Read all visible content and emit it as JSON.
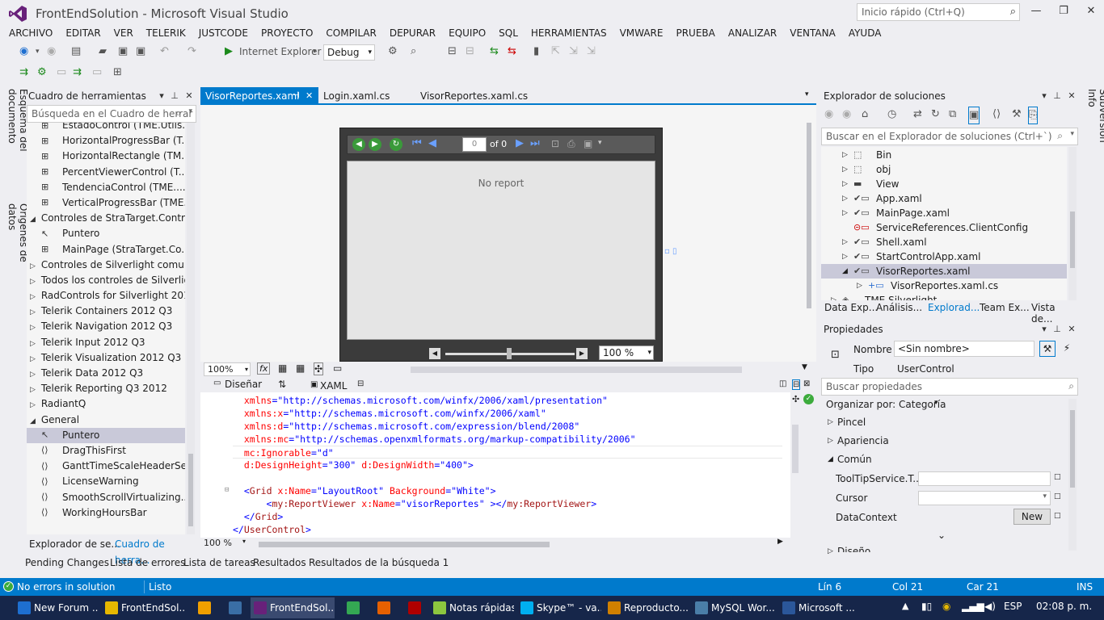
{
  "title": {
    "app": "FrontEndSolution - Microsoft Visual Studio",
    "quick_launch": "Inicio rápido (Ctrl+Q)"
  },
  "menu": [
    "ARCHIVO",
    "EDITAR",
    "VER",
    "TELERIK",
    "JUSTCODE",
    "PROYECTO",
    "COMPILAR",
    "DEPURAR",
    "EQUIPO",
    "SQL",
    "HERRAMIENTAS",
    "VMWARE",
    "PRUEBA",
    "ANALIZAR",
    "VENTANA",
    "AYUDA"
  ],
  "toolbar": {
    "run_target": "Internet Explorer",
    "config": "Debug"
  },
  "left_vtabs": [
    "Esquema del documento",
    "Orígenes de datos"
  ],
  "right_vtab": "Subversion Info",
  "toolbox": {
    "title": "Cuadro de herramientas",
    "search_placeholder": "Búsqueda en el Cuadro de herrar",
    "items": [
      {
        "type": "item",
        "label": "EstadoControl (TME.Utils..."
      },
      {
        "type": "item",
        "label": "HorizontalProgressBar (T..."
      },
      {
        "type": "item",
        "label": "HorizontalRectangle (TM..."
      },
      {
        "type": "item",
        "label": "PercentViewerControl (T..."
      },
      {
        "type": "item",
        "label": "TendenciaControl (TME...."
      },
      {
        "type": "item",
        "label": "VerticalProgressBar (TME..."
      },
      {
        "type": "group-open",
        "label": "Controles de StraTarget.Contro..."
      },
      {
        "type": "pointer",
        "label": "Puntero"
      },
      {
        "type": "item",
        "label": "MainPage (StraTarget.Co..."
      },
      {
        "type": "group",
        "label": "Controles de Silverlight comunes"
      },
      {
        "type": "group",
        "label": "Todos los controles de Silverlight"
      },
      {
        "type": "group",
        "label": "RadControls for Silverlight 2012..."
      },
      {
        "type": "group",
        "label": "Telerik Containers 2012 Q3"
      },
      {
        "type": "group",
        "label": "Telerik Navigation 2012 Q3"
      },
      {
        "type": "group",
        "label": "Telerik Input 2012 Q3"
      },
      {
        "type": "group",
        "label": "Telerik Visualization 2012 Q3"
      },
      {
        "type": "group",
        "label": "Telerik Data 2012 Q3"
      },
      {
        "type": "group",
        "label": "Telerik Reporting Q3 2012"
      },
      {
        "type": "group",
        "label": "RadiantQ"
      },
      {
        "type": "group-open",
        "label": "General"
      },
      {
        "type": "pointer-sel",
        "label": "Puntero"
      },
      {
        "type": "code",
        "label": "DragThisFirst"
      },
      {
        "type": "code",
        "label": "GanttTimeScaleHeaderSe..."
      },
      {
        "type": "code",
        "label": "LicenseWarning"
      },
      {
        "type": "code",
        "label": "SmoothScrollVirtualizing..."
      },
      {
        "type": "code",
        "label": "WorkingHoursBar"
      }
    ],
    "bottom_tabs": [
      "Explorador de se...",
      "Cuadro de herra..."
    ]
  },
  "doc_tabs": [
    {
      "label": "VisorReportes.xaml",
      "active": true
    },
    {
      "label": "Login.xaml.cs",
      "active": false
    },
    {
      "label": "VisorReportes.xaml.cs",
      "active": false
    }
  ],
  "report_viewer": {
    "page": "0",
    "of": "of 0",
    "no_report": "No report",
    "zoom": "100 %"
  },
  "designer": {
    "zoom": "100%",
    "fx": "fx",
    "tab_design": "Diseñar",
    "tab_xaml": "XAML"
  },
  "code": [
    {
      "indent": "  ",
      "parts": [
        [
          "attr",
          "xmlns"
        ],
        [
          "punct",
          "="
        ],
        [
          "val",
          "\"http://schemas.microsoft.com/winfx/2006/xaml/presentation\""
        ]
      ]
    },
    {
      "indent": "  ",
      "parts": [
        [
          "attr",
          "xmlns:x"
        ],
        [
          "punct",
          "="
        ],
        [
          "val",
          "\"http://schemas.microsoft.com/winfx/2006/xaml\""
        ]
      ]
    },
    {
      "indent": "  ",
      "parts": [
        [
          "attr",
          "xmlns:d"
        ],
        [
          "punct",
          "="
        ],
        [
          "val",
          "\"http://schemas.microsoft.com/expression/blend/2008\""
        ]
      ]
    },
    {
      "indent": "  ",
      "parts": [
        [
          "attr",
          "xmlns:mc"
        ],
        [
          "punct",
          "="
        ],
        [
          "val",
          "\"http://schemas.openxmlformats.org/markup-compatibility/2006\""
        ]
      ]
    },
    {
      "indent": "  ",
      "parts": [
        [
          "attr",
          "mc:Ignorable"
        ],
        [
          "punct",
          "="
        ],
        [
          "val",
          "\"d\""
        ]
      ]
    },
    {
      "indent": "  ",
      "parts": [
        [
          "attr",
          "d:DesignHeight"
        ],
        [
          "punct",
          "="
        ],
        [
          "val",
          "\"300\""
        ],
        [
          "plain",
          " "
        ],
        [
          "attr",
          "d:DesignWidth"
        ],
        [
          "punct",
          "="
        ],
        [
          "val",
          "\"400\""
        ],
        [
          "punct",
          ">"
        ]
      ]
    },
    {
      "indent": "",
      "parts": []
    },
    {
      "indent": "  ",
      "parts": [
        [
          "punct",
          "<"
        ],
        [
          "tag",
          "Grid"
        ],
        [
          "plain",
          " "
        ],
        [
          "attr",
          "x:Name"
        ],
        [
          "punct",
          "="
        ],
        [
          "val",
          "\"LayoutRoot\""
        ],
        [
          "plain",
          " "
        ],
        [
          "attr",
          "Background"
        ],
        [
          "punct",
          "="
        ],
        [
          "val",
          "\"White\""
        ],
        [
          "punct",
          ">"
        ]
      ]
    },
    {
      "indent": "      ",
      "parts": [
        [
          "punct",
          "<"
        ],
        [
          "tag",
          "my:ReportViewer"
        ],
        [
          "plain",
          " "
        ],
        [
          "attr",
          "x:Name"
        ],
        [
          "punct",
          "="
        ],
        [
          "val",
          "\"visorReportes\""
        ],
        [
          "plain",
          " "
        ],
        [
          "punct",
          "></"
        ],
        [
          "tag",
          "my:ReportViewer"
        ],
        [
          "punct",
          ">"
        ]
      ]
    },
    {
      "indent": "  ",
      "parts": [
        [
          "punct",
          "</"
        ],
        [
          "tag",
          "Grid"
        ],
        [
          "punct",
          ">"
        ]
      ]
    },
    {
      "indent": "",
      "parts": [
        [
          "punct",
          "</"
        ],
        [
          "tag",
          "UserControl"
        ],
        [
          "punct",
          ">"
        ]
      ]
    }
  ],
  "code_zoom": "100 %",
  "solution_explorer": {
    "title": "Explorador de soluciones",
    "search_placeholder": "Buscar en el Explorador de soluciones (Ctrl+`)",
    "items": [
      {
        "label": "Bin",
        "indent": 0,
        "icon": "dotted-folder-icon"
      },
      {
        "label": "obj",
        "indent": 0,
        "icon": "dotted-folder-icon"
      },
      {
        "label": "View",
        "indent": 0,
        "icon": "folder-icon"
      },
      {
        "label": "App.xaml",
        "indent": 0,
        "icon": "xaml-file-icon"
      },
      {
        "label": "MainPage.xaml",
        "indent": 0,
        "icon": "xaml-file-icon"
      },
      {
        "label": "ServiceReferences.ClientConfig",
        "indent": 0,
        "icon": "config-file-icon"
      },
      {
        "label": "Shell.xaml",
        "indent": 0,
        "icon": "xaml-file-icon"
      },
      {
        "label": "StartControlApp.xaml",
        "indent": 0,
        "icon": "xaml-file-icon"
      },
      {
        "label": "VisorReportes.xaml",
        "indent": 0,
        "icon": "xaml-file-icon",
        "selected": true
      },
      {
        "label": "VisorReportes.xaml.cs",
        "indent": 1,
        "icon": "cs-file-icon"
      },
      {
        "label": "TME.Silverlight...",
        "indent": -1,
        "icon": "project-icon"
      }
    ],
    "bottom_tabs": [
      "Data Exp...",
      "Análisis...",
      "Explorad...",
      "Team Ex...",
      "Vista de..."
    ]
  },
  "properties": {
    "title": "Propiedades",
    "name_label": "Nombre",
    "name_value": "<Sin nombre>",
    "type_label": "Tipo",
    "type_value": "UserControl",
    "search_placeholder": "Buscar propiedades",
    "organize": "Organizar por: Categoría",
    "categories": [
      "Pincel",
      "Apariencia",
      "Común"
    ],
    "rows": [
      {
        "label": "ToolTipService.T..."
      },
      {
        "label": "Cursor"
      },
      {
        "label": "DataContext",
        "button": "New"
      }
    ],
    "cut_category": "Diseño"
  },
  "bottom_tabs": [
    "Pending Changes",
    "Lista de errores",
    "Lista de tareas",
    "Resultados",
    "Resultados de la búsqueda 1"
  ],
  "status": {
    "errors": "No errors in solution",
    "ready": "Listo",
    "line": "Lín 6",
    "col": "Col 21",
    "car": "Car 21",
    "mode": "INS"
  },
  "taskbar": {
    "items": [
      {
        "label": "New Forum ...",
        "color": "#1e6fd0"
      },
      {
        "label": "FrontEndSol...",
        "color": "#e6b800"
      },
      {
        "label": "",
        "color": "#f0a000"
      },
      {
        "label": "",
        "color": "#3a6ea5"
      },
      {
        "label": "FrontEndSol...",
        "color": "#68217a"
      },
      {
        "label": "",
        "color": "#34a853"
      },
      {
        "label": "",
        "color": "#e66000"
      },
      {
        "label": "",
        "color": "#b00000"
      },
      {
        "label": "Notas rápidas",
        "color": "#8cc63f"
      },
      {
        "label": "Skype™ - va...",
        "color": "#00aff0"
      },
      {
        "label": "Reproducto...",
        "color": "#d08000"
      },
      {
        "label": "MySQL Wor...",
        "color": "#4a7ea8"
      },
      {
        "label": "Microsoft ...",
        "color": "#2b579a"
      }
    ],
    "lang": "ESP",
    "time": "02:08 p. m."
  }
}
